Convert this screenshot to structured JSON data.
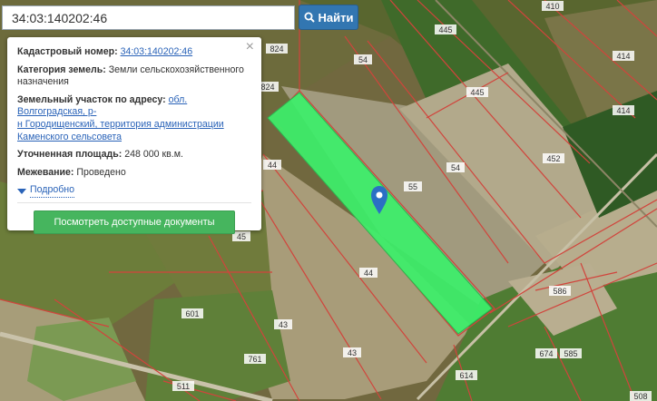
{
  "search": {
    "value": "34:03:140202:46",
    "button_label": "Найти"
  },
  "card": {
    "cadastral_label": "Кадастровый номер:",
    "cadastral_value": "34:03:140202:46",
    "category_label": "Категория земель:",
    "category_value_1": "Земли сельскохозяйственного",
    "category_value_2": "назначения",
    "address_label": "Земельный участок по адресу:",
    "address_value_1": "обл. Волгоградская, р-",
    "address_value_2": "н Городищенский, территория администрации",
    "address_value_3": "Каменского сельсовета",
    "area_label": "Уточненная площадь:",
    "area_value": "248 000 кв.м.",
    "survey_label": "Межевание:",
    "survey_value": "Проведено",
    "details_label": "Подробно",
    "docs_button_label": "Посмотреть доступные документы",
    "close_symbol": "×"
  },
  "map": {
    "plot_numbers": [
      "410",
      "445",
      "414",
      "824",
      "54",
      "445",
      "824",
      "414",
      "452",
      "44",
      "54",
      "55",
      "45",
      "44",
      "586",
      "601",
      "43",
      "43",
      "761",
      "614",
      "674",
      "585",
      "511",
      "508"
    ],
    "highlight_color": "#3cf06a",
    "boundary_color": "#d1443c"
  }
}
